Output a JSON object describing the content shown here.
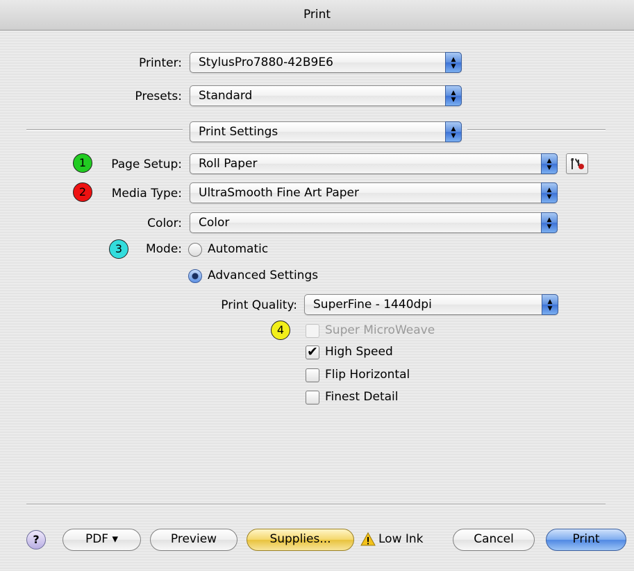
{
  "window": {
    "title": "Print"
  },
  "printer": {
    "label": "Printer:",
    "value": "StylusPro7880-42B9E6"
  },
  "presets": {
    "label": "Presets:",
    "value": "Standard"
  },
  "panel": {
    "value": "Print Settings"
  },
  "page_setup": {
    "badge": "1",
    "badge_color": "#22cc22",
    "label": "Page Setup:",
    "value": "Roll Paper",
    "utility_icon": "wrench-icon"
  },
  "media_type": {
    "badge": "2",
    "badge_color": "#ee1111",
    "label": "Media Type:",
    "value": "UltraSmooth Fine Art Paper"
  },
  "color": {
    "label": "Color:",
    "value": "Color"
  },
  "mode": {
    "badge": "3",
    "badge_color": "#33dddd",
    "label": "Mode:",
    "automatic": "Automatic",
    "advanced": "Advanced Settings",
    "selected": "Advanced Settings"
  },
  "print_quality": {
    "label": "Print Quality:",
    "value": "SuperFine - 1440dpi"
  },
  "options": {
    "badge": "4",
    "badge_color": "#f2ef1a",
    "super_microweave": {
      "label": "Super MicroWeave",
      "checked": false,
      "enabled": false
    },
    "high_speed": {
      "label": "High Speed",
      "checked": true
    },
    "flip_horizontal": {
      "label": "Flip Horizontal",
      "checked": false
    },
    "finest_detail": {
      "label": "Finest Detail",
      "checked": false
    }
  },
  "footer": {
    "help": "?",
    "pdf": "PDF ▾",
    "preview": "Preview",
    "supplies": "Supplies...",
    "low_ink": "Low Ink",
    "cancel": "Cancel",
    "print": "Print"
  }
}
